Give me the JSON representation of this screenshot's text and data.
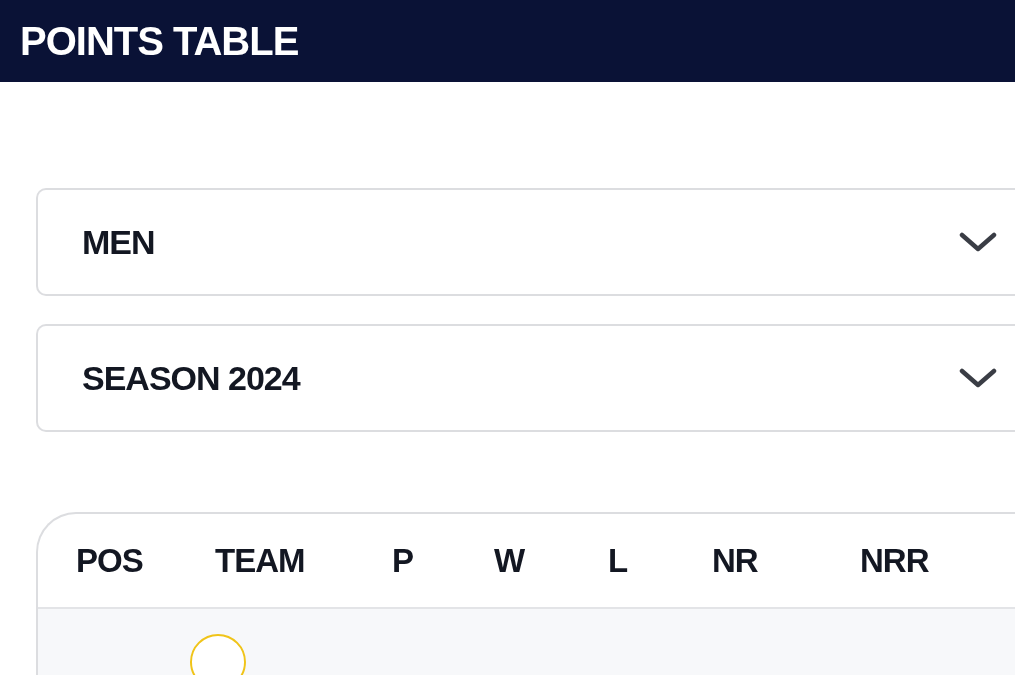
{
  "header": {
    "title": "POINTS TABLE"
  },
  "filters": [
    {
      "value": "MEN"
    },
    {
      "value": "SEASON 2024"
    }
  ],
  "table": {
    "columns": [
      "POS",
      "TEAM",
      "P",
      "W",
      "L",
      "NR",
      "NRR"
    ]
  }
}
